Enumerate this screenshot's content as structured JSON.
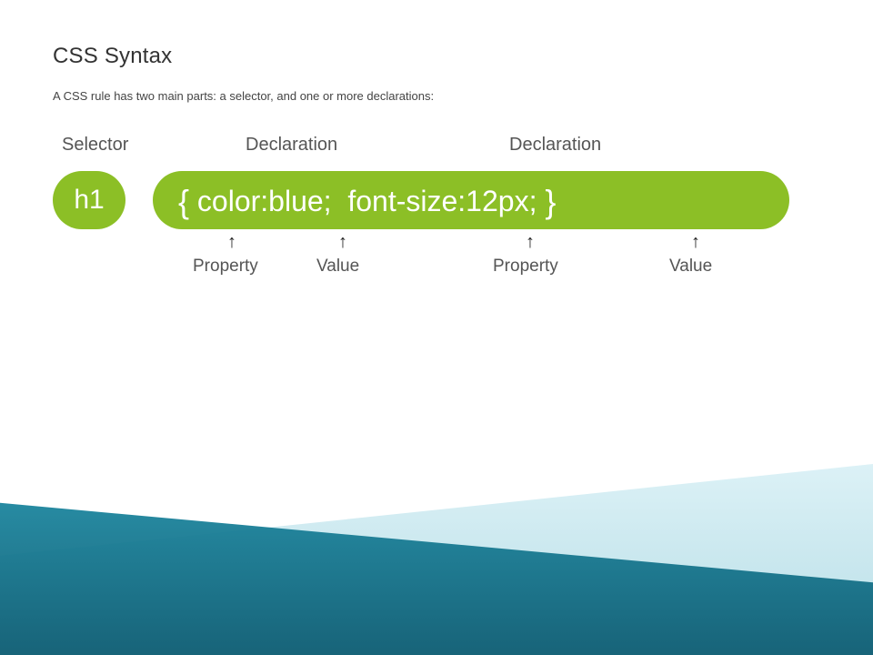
{
  "title": "CSS Syntax",
  "subtitle": "A CSS rule has two main parts: a selector, and one or more declarations:",
  "top_labels": {
    "selector": "Selector",
    "declaration1": "Declaration",
    "declaration2": "Declaration"
  },
  "selector_text": "h1",
  "declaration": {
    "open_brace": "{",
    "prop1": "color",
    "colon1": ":",
    "val1": "blue",
    "semi1": ";",
    "space": " ",
    "prop2": "font-size",
    "colon2": ":",
    "val2": "12px",
    "semi2": ";",
    "close_brace": "}"
  },
  "bottom_labels": {
    "property1": "Property",
    "value1": "Value",
    "property2": "Property",
    "value2": "Value"
  },
  "arrow_glyph": "↑"
}
